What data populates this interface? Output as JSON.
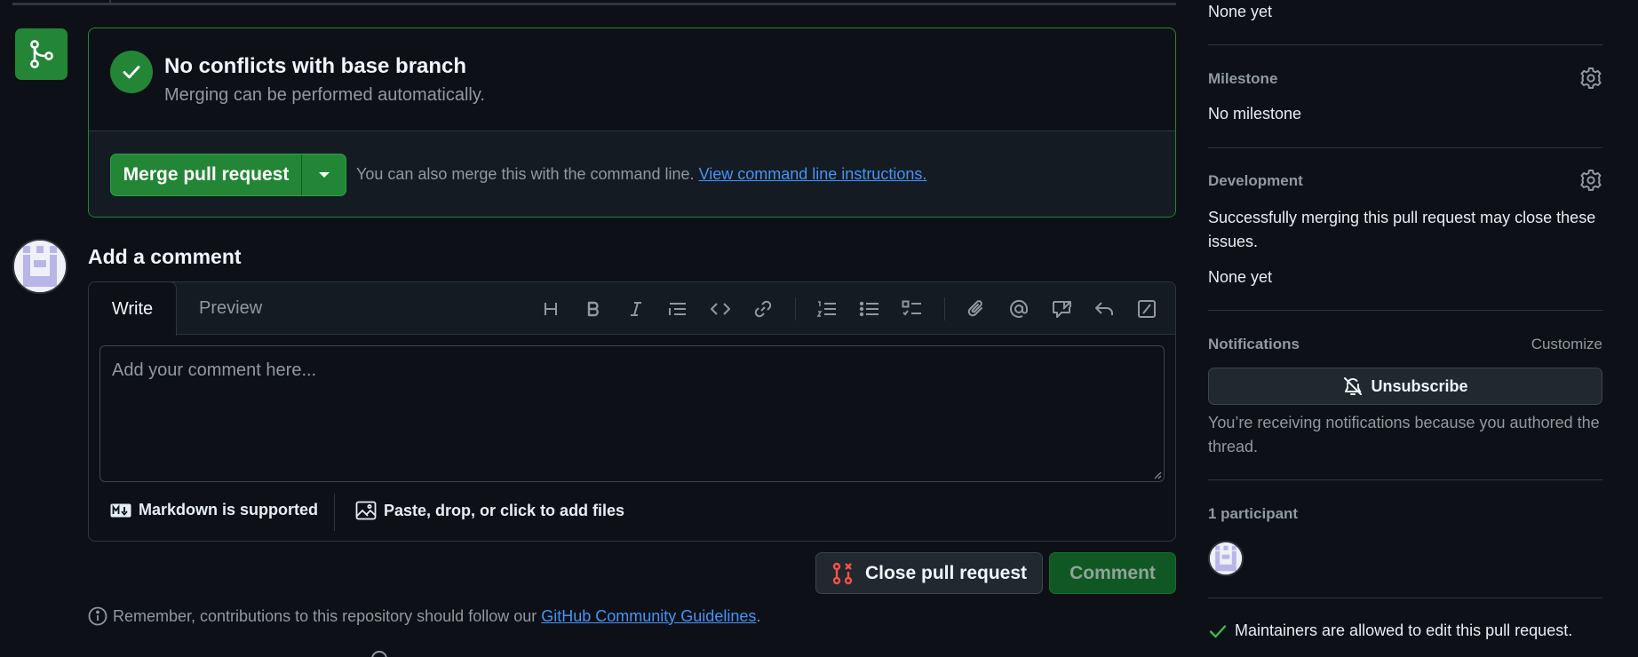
{
  "merge": {
    "title": "No conflicts with base branch",
    "subtitle": "Merging can be performed automatically.",
    "button_label": "Merge pull request",
    "hint_text": "You can also merge this with the command line.",
    "hint_link": "View command line instructions."
  },
  "comment": {
    "heading": "Add a comment",
    "tabs": {
      "write": "Write",
      "preview": "Preview"
    },
    "placeholder": "Add your comment here...",
    "markdown_note": "Markdown is supported",
    "attach_note": "Paste, drop, or click to add files",
    "toolbar_icons": [
      "heading-icon",
      "bold-icon",
      "italic-icon",
      "quote-icon",
      "code-icon",
      "link-icon",
      "ordered-list-icon",
      "unordered-list-icon",
      "task-list-icon",
      "attach-icon",
      "mention-icon",
      "reference-icon",
      "reply-icon",
      "slash-command-icon"
    ]
  },
  "actions": {
    "close_label": "Close pull request",
    "comment_label": "Comment"
  },
  "guidelines": {
    "prefix": "Remember, contributions to this repository should follow our",
    "link": "GitHub Community Guidelines",
    "suffix": "."
  },
  "sidebar": {
    "top_value": "None yet",
    "milestone": {
      "label": "Milestone",
      "value": "No milestone"
    },
    "development": {
      "label": "Development",
      "description": "Successfully merging this pull request may close these issues.",
      "value": "None yet"
    },
    "notifications": {
      "label": "Notifications",
      "customize": "Customize",
      "button_label": "Unsubscribe",
      "note": "You’re receiving notifications because you authored the thread."
    },
    "participants": {
      "label": "1 participant"
    },
    "maintainers_note": "Maintainers are allowed to edit this pull request."
  },
  "colors": {
    "background": "#0d1117",
    "success": "#238636",
    "link": "#4493f8",
    "danger": "#f85149",
    "muted": "#9198a1"
  }
}
